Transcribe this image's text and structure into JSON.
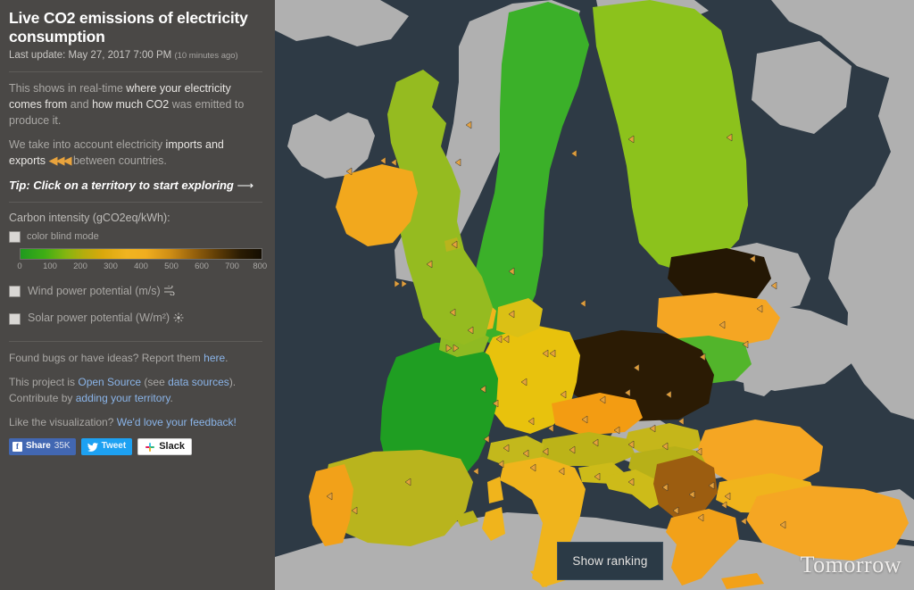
{
  "sidebar": {
    "title": "Live CO2 emissions of electricity consumption",
    "last_update_prefix": "Last update:",
    "last_update_time": "May 27, 2017 7:00 PM",
    "last_update_ago": "(10 minutes ago)",
    "intro": {
      "p1_a": "This shows in real-time ",
      "p1_b": "where your electricity comes from",
      "p1_c": " and ",
      "p1_d": "how much CO2",
      "p1_e": " was emitted to produce it.",
      "p2_a": "We take into account electricity ",
      "p2_b": "imports and exports",
      "p2_icon": "◀◀◀",
      "p2_c": " between countries."
    },
    "tip": "Tip: Click on a territory to start exploring",
    "tip_arrow": "⟶",
    "legend": {
      "label": "Carbon intensity (gCO2eq/kWh):",
      "colorblind_label": "color blind mode",
      "ticks": [
        "0",
        "100",
        "200",
        "300",
        "400",
        "500",
        "600",
        "700",
        "800"
      ],
      "scale_min": 0,
      "scale_max": 800
    },
    "options": [
      {
        "label": "Wind power potential (m/s)",
        "icon": "wind-icon"
      },
      {
        "label": "Solar power potential (W/m²)",
        "icon": "sun-icon"
      }
    ],
    "footer": {
      "bugs_a": "Found bugs or have ideas? Report them ",
      "bugs_link": "here",
      "bugs_b": ".",
      "os_a": "This project is ",
      "os_link1": "Open Source",
      "os_b": " (see ",
      "os_link2": "data sources",
      "os_c": "). Contribute by ",
      "os_link3": "adding your territory",
      "os_d": ".",
      "fb_a": "Like the visualization? ",
      "fb_link": "We'd love your feedback!",
      "social": {
        "facebook_label": "Share",
        "facebook_count": "35K",
        "facebook_glyph": "f",
        "twitter_label": "Tweet",
        "slack_label": "Slack"
      }
    }
  },
  "map": {
    "show_ranking_label": "Show ranking",
    "brand": "Tomorrow",
    "ocean_color": "#2e3a45",
    "nodata_color": "#b0b0b0",
    "territories": [
      {
        "name": "Sweden",
        "color": "#3bb029",
        "intensity": 45
      },
      {
        "name": "Finland",
        "color": "#8cc21c",
        "intensity": 170
      },
      {
        "name": "Norway",
        "color": "#b0b0b0",
        "intensity": null
      },
      {
        "name": "Iceland",
        "color": "#b0b0b0",
        "intensity": null
      },
      {
        "name": "Estonia",
        "color": "#241704",
        "intensity": 760
      },
      {
        "name": "Latvia",
        "color": "#f5a623",
        "intensity": 450
      },
      {
        "name": "Lithuania",
        "color": "#52b52b",
        "intensity": 90
      },
      {
        "name": "Poland",
        "color": "#2b1b04",
        "intensity": 740
      },
      {
        "name": "Germany",
        "color": "#e8c20d",
        "intensity": 330
      },
      {
        "name": "Czechia",
        "color": "#f39c12",
        "intensity": 470
      },
      {
        "name": "Austria",
        "color": "#bcb318",
        "intensity": 270
      },
      {
        "name": "Switzerland",
        "color": "#c3b81c",
        "intensity": 250
      },
      {
        "name": "Slovakia",
        "color": "#c5b61a",
        "intensity": 260
      },
      {
        "name": "Hungary",
        "color": "#b7b018",
        "intensity": 280
      },
      {
        "name": "Slovenia",
        "color": "#cdbb19",
        "intensity": 250
      },
      {
        "name": "Italy",
        "color": "#f0b41c",
        "intensity": 400
      },
      {
        "name": "France",
        "color": "#1f9e22",
        "intensity": 60
      },
      {
        "name": "Spain",
        "color": "#b9b41d",
        "intensity": 260
      },
      {
        "name": "Portugal",
        "color": "#f2a119",
        "intensity": 440
      },
      {
        "name": "United Kingdom",
        "color": "#95bb20",
        "intensity": 210
      },
      {
        "name": "Ireland",
        "color": "#f2a81d",
        "intensity": 430
      },
      {
        "name": "Netherlands",
        "color": "#f0b41c",
        "intensity": 400
      },
      {
        "name": "Belgium",
        "color": "#8fba22",
        "intensity": 190
      },
      {
        "name": "Denmark",
        "color": "#dbc015",
        "intensity": 310
      },
      {
        "name": "Romania",
        "color": "#f5a623",
        "intensity": 450
      },
      {
        "name": "Bulgaria",
        "color": "#f0b41c",
        "intensity": 400
      },
      {
        "name": "Greece",
        "color": "#f2a119",
        "intensity": 440
      },
      {
        "name": "Turkey",
        "color": "#f5a623",
        "intensity": 450
      },
      {
        "name": "Serbia",
        "color": "#9c5d10",
        "intensity": 620
      },
      {
        "name": "Croatia",
        "color": "#cdbb19",
        "intensity": 250
      },
      {
        "name": "Bosnia",
        "color": "#a8a8a8",
        "intensity": null
      },
      {
        "name": "Ukraine",
        "color": "#a8a8a8",
        "intensity": null
      },
      {
        "name": "Belarus",
        "color": "#a8a8a8",
        "intensity": null
      },
      {
        "name": "Russia",
        "color": "#a8a8a8",
        "intensity": null
      },
      {
        "name": "Morocco",
        "color": "#b0b0b0",
        "intensity": null
      },
      {
        "name": "Algeria",
        "color": "#b0b0b0",
        "intensity": null
      }
    ]
  }
}
